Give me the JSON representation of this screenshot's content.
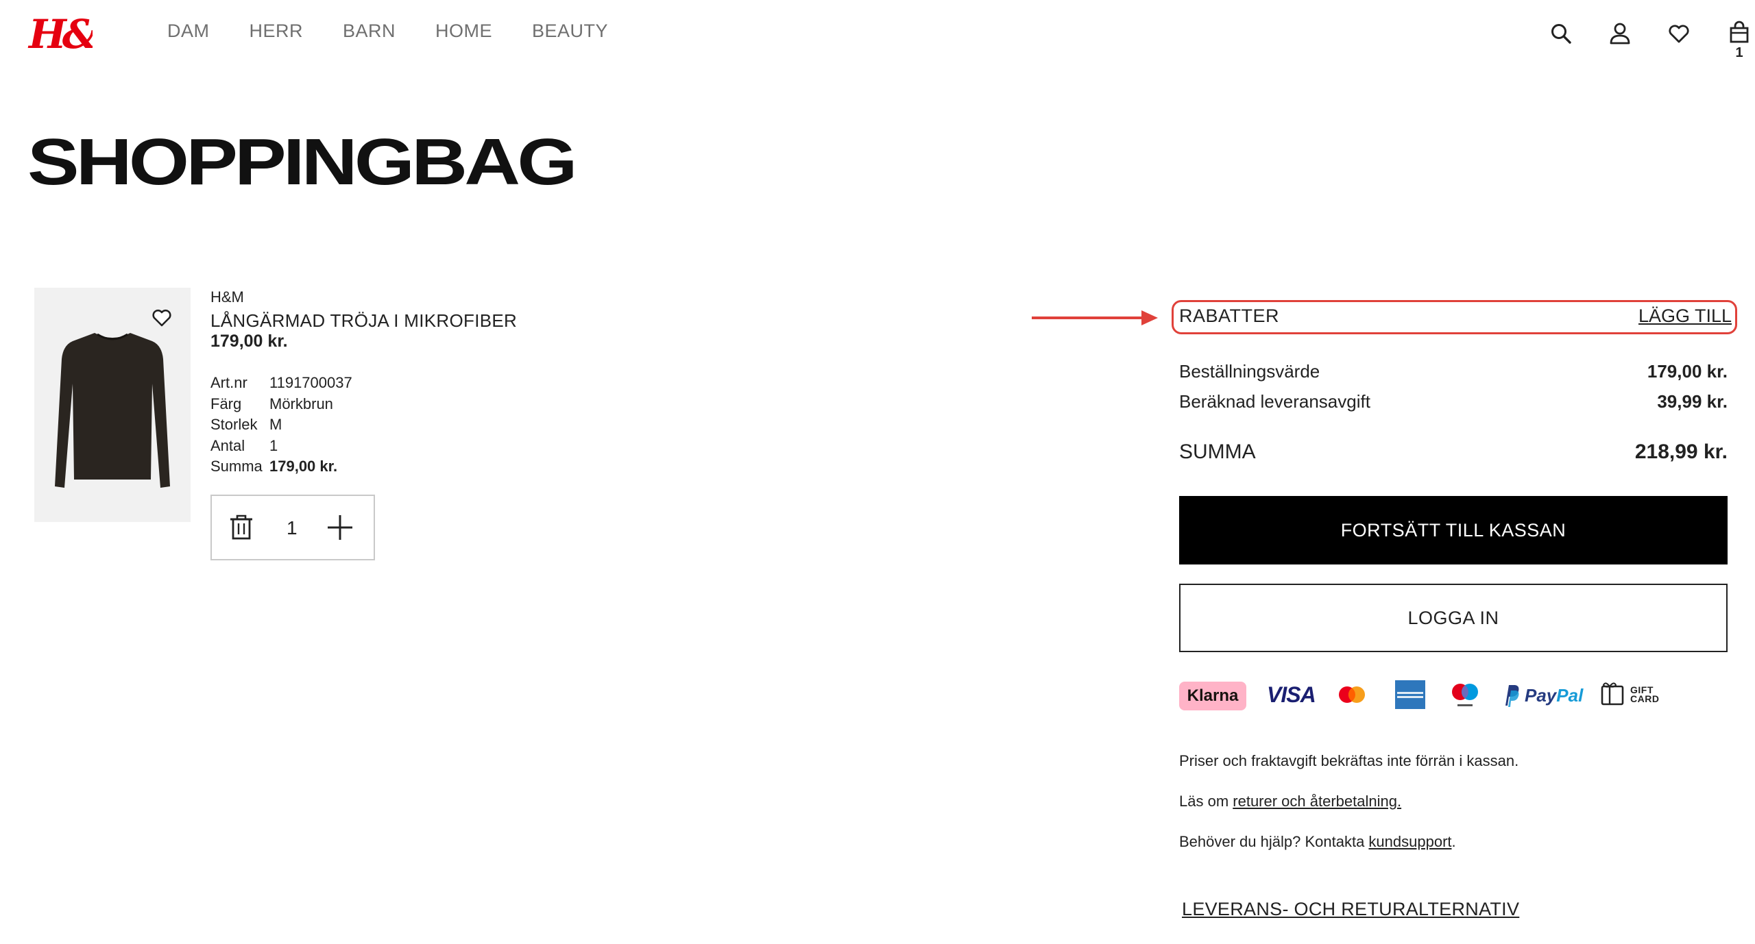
{
  "header": {
    "logo_text": "H&M",
    "nav": [
      "DAM",
      "HERR",
      "BARN",
      "HOME",
      "BEAUTY"
    ],
    "icons": [
      "search-icon",
      "account-icon",
      "favorites-icon",
      "bag-icon"
    ],
    "bag_count": "1"
  },
  "page_title": "SHOPPINGBAG",
  "product": {
    "brand": "H&M",
    "name": "LÅNGÄRMAD TRÖJA I MIKROFIBER",
    "price": "179,00 kr.",
    "details": [
      {
        "key": "Art.nr",
        "value": "1191700037"
      },
      {
        "key": "Färg",
        "value": "Mörkbrun"
      },
      {
        "key": "Storlek",
        "value": "M"
      },
      {
        "key": "Antal",
        "value": "1"
      },
      {
        "key": "Summa",
        "value": "179,00 kr."
      }
    ],
    "quantity": "1",
    "image_color": "#2a2520"
  },
  "summary": {
    "discounts_label": "RABATTER",
    "add_label": "LÄGG TILL",
    "order_value_label": "Beställningsvärde",
    "order_value": "179,00 kr.",
    "delivery_label": "Beräknad leveransavgift",
    "delivery_value": "39,99 kr.",
    "total_label": "SUMMA",
    "total_value": "218,99 kr.",
    "checkout_label": "FORTSÄTT TILL KASSAN",
    "login_label": "LOGGA IN"
  },
  "payment_methods": {
    "klarna": "Klarna",
    "visa": "VISA",
    "paypal_a": "Pay",
    "paypal_b": "Pal",
    "gift_1": "GIFT",
    "gift_2": "CARD"
  },
  "info": {
    "line1": "Priser och fraktavgift bekräftas inte förrän i kassan.",
    "line2_prefix": "Läs om ",
    "line2_link": "returer och återbetalning.",
    "line3_prefix": "Behöver du hjälp? Kontakta ",
    "line3_link": "kundsupport",
    "line3_suffix": "."
  },
  "delivery_link": "LEVERANS- OCH RETURALTERNATIV",
  "colors": {
    "accent_red": "#e0413a",
    "logo_red": "#e50010",
    "button_black": "#000000"
  }
}
